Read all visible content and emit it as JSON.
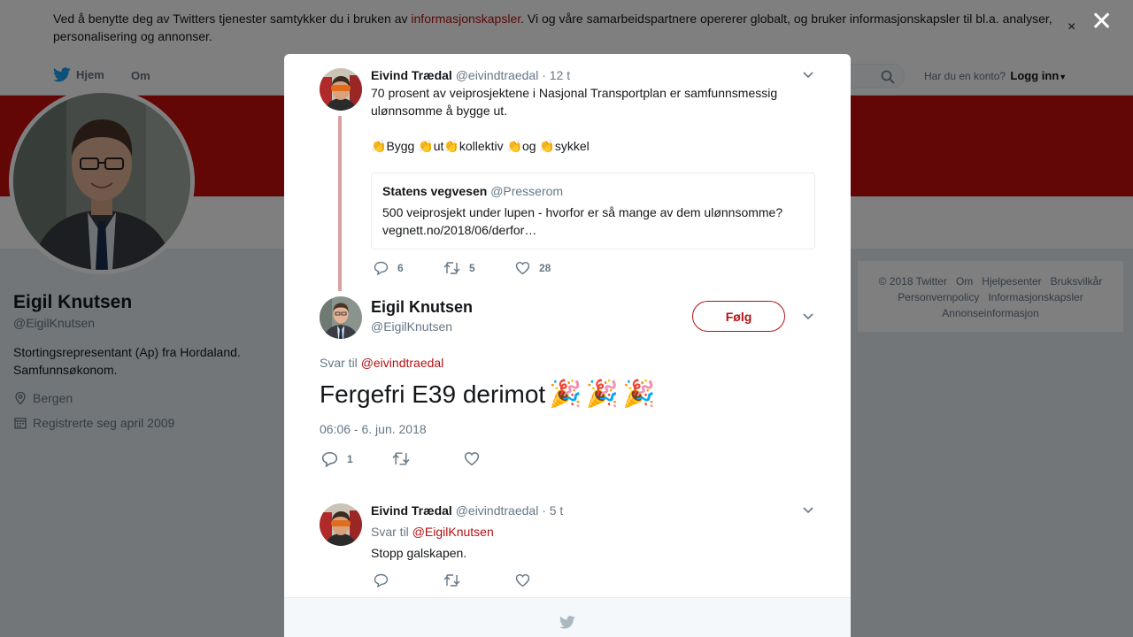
{
  "cookie": {
    "text_before": "Ved å benytte deg av Twitters tjenester samtykker du i bruken av ",
    "link": "informasjonskapsler",
    "text_after": ". Vi og våre samarbeidspartnere opererer globalt, og bruker informasjonskapsler til bl.a. analyser, personalisering og annonser.",
    "close": "×"
  },
  "nav": {
    "home": "Hjem",
    "about": "Om",
    "account_prompt": "Har du en konto?",
    "login": "Logg inn"
  },
  "profile": {
    "name": "Eigil Knutsen",
    "handle": "@EigilKnutsen",
    "bio": "Stortingsrepresentant (Ap) fra Hordaland. Samfunnsøkonom.",
    "location": "Bergen",
    "joined": "Registrerte seg april 2009"
  },
  "footer": {
    "links": [
      "© 2018 Twitter",
      "Om",
      "Hjelpesenter",
      "Bruksvilkår",
      "Personvernpolicy",
      "Informasjonskapsler",
      "Annonseinformasjon"
    ]
  },
  "overlay_close": "✕",
  "tweet1": {
    "name": "Eivind Trædal",
    "handle": "@eivindtraedal",
    "time": "· 12 t",
    "text": "70 prosent av veiprosjektene i Nasjonal Transportplan er  samfunnsmessig ulønnsomme å bygge ut.",
    "words": [
      "Bygg",
      "ut",
      "kollektiv",
      "og",
      "sykkel"
    ],
    "quote": {
      "name": "Statens vegvesen",
      "handle": "@Presserom",
      "text": "500 veiprosjekt under lupen - hvorfor er så mange av dem ulønnsomme? vegnett.no/2018/06/derfor…"
    },
    "replies": "6",
    "retweets": "5",
    "likes": "28"
  },
  "main_tweet": {
    "name": "Eigil Knutsen",
    "handle": "@EigilKnutsen",
    "follow": "Følg",
    "reply_label": "Svar til",
    "reply_mention": "@eivindtraedal",
    "text": "Fergefri E39 derimot",
    "timestamp": "06:06 - 6. jun. 2018",
    "replies": "1"
  },
  "tweet3": {
    "name": "Eivind Trædal",
    "handle": "@eivindtraedal",
    "time": "· 5 t",
    "reply_label": "Svar til",
    "reply_mention": "@EigilKnutsen",
    "text": "Stopp galskapen."
  },
  "colors": {
    "accent": "#b31212",
    "banner": "#c70c0c",
    "thread_line": "#d9a0a0"
  }
}
